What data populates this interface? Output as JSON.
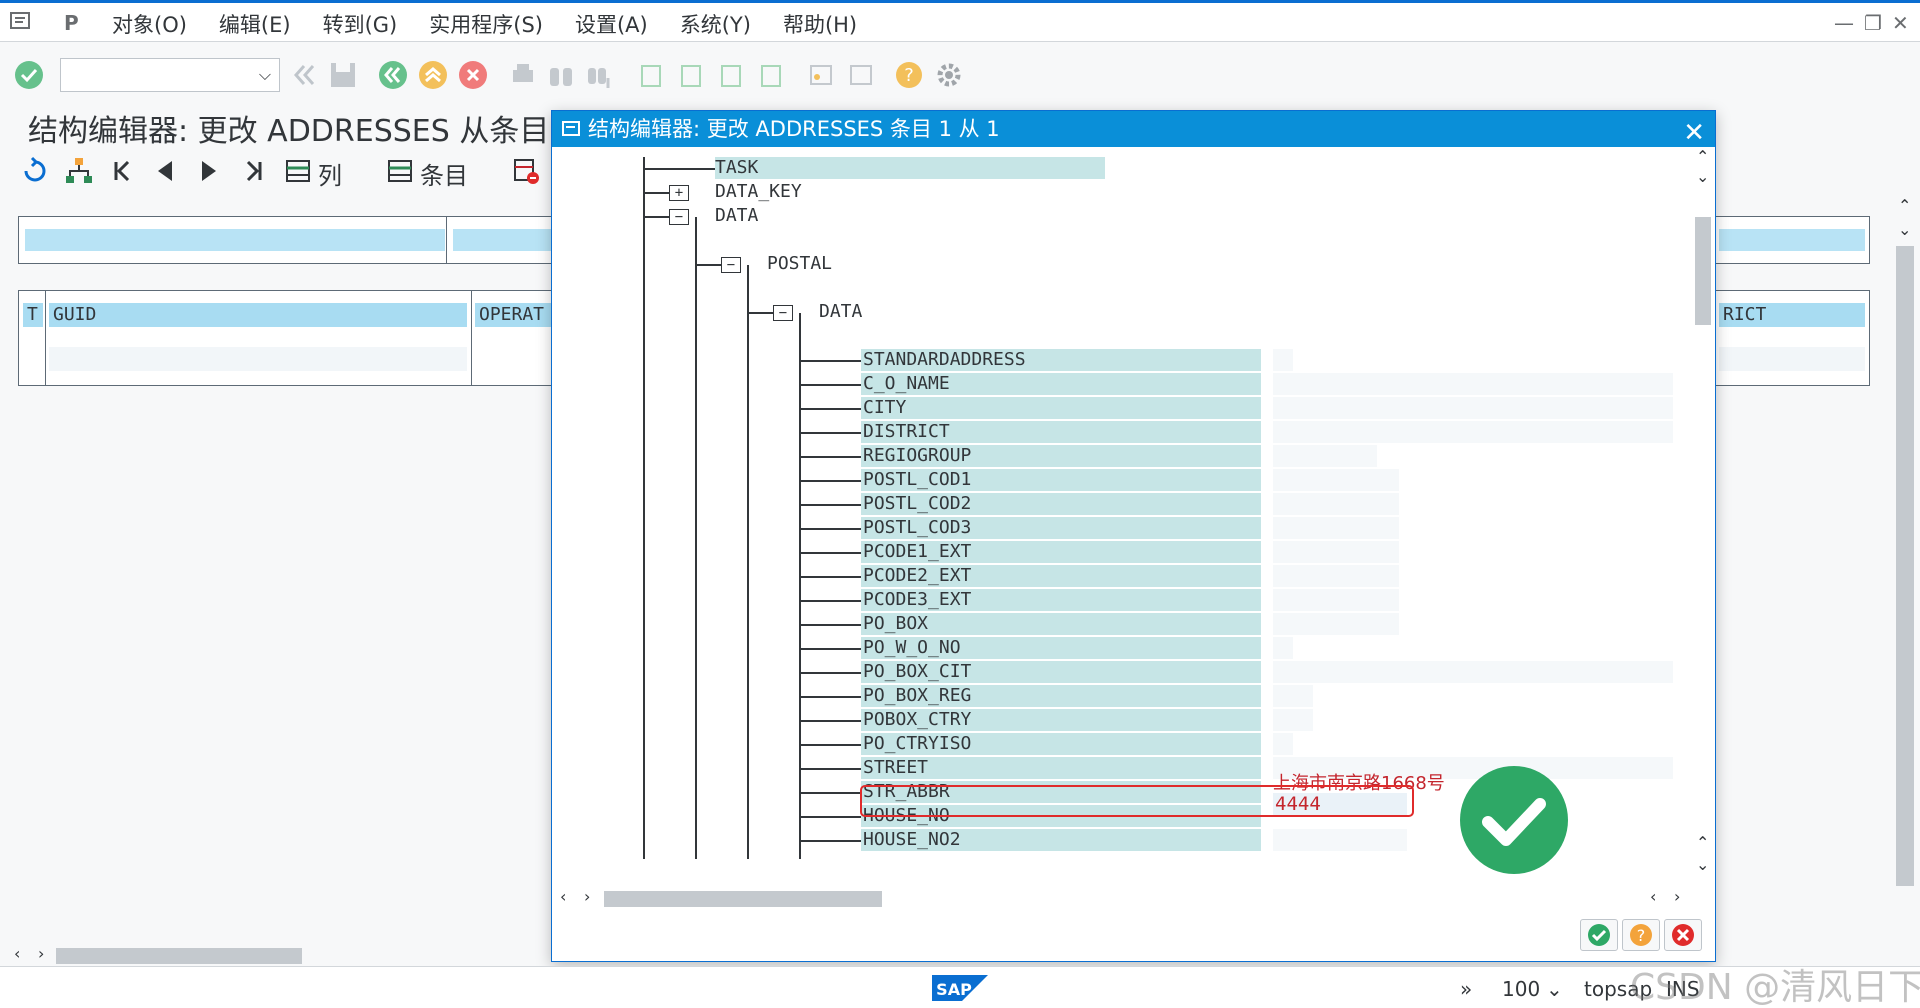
{
  "menu": {
    "items": [
      "对象(O)",
      "编辑(E)",
      "转到(G)",
      "实用程序(S)",
      "设置(A)",
      "系统(Y)",
      "帮助(H)"
    ]
  },
  "window_controls": [
    "—",
    "❐",
    "✕"
  ],
  "main": {
    "title": "结构编辑器: 更改 ADDRESSES 从条目",
    "app_toolbar": {
      "columns_label": "列",
      "entries_label": "条目"
    },
    "grid": {
      "headers": [
        "T",
        "GUID",
        "OPERAT",
        "RICT"
      ]
    }
  },
  "dialog": {
    "title": "结构编辑器: 更改 ADDRESSES 条目 1 从 1",
    "close": "✕",
    "nodes": [
      {
        "label": "TASK"
      },
      {
        "label": "DATA_KEY"
      },
      {
        "label": "DATA"
      },
      {
        "label": "POSTAL"
      },
      {
        "label": "DATA"
      }
    ],
    "fields": [
      "STANDARDADDRESS",
      "C_O_NAME",
      "CITY",
      "DISTRICT",
      "REGIOGROUP",
      "POSTL_COD1",
      "POSTL_COD2",
      "POSTL_COD3",
      "PCODE1_EXT",
      "PCODE2_EXT",
      "PCODE3_EXT",
      "PO_BOX",
      "PO_W_O_NO",
      "PO_BOX_CIT",
      "PO_BOX_REG",
      "POBOX_CTRY",
      "PO_CTRYISO",
      "STREET",
      "STR_ABBR",
      "HOUSE_NO",
      "HOUSE_NO2"
    ],
    "street_value": "上海市南京路1668号",
    "house_no_value": "4444",
    "expander_plus": "+",
    "expander_minus": "−"
  },
  "status": {
    "zoom": "100",
    "system": "topsap",
    "mode": "INS",
    "watermark": "CSDN @清风日下"
  },
  "colors": {
    "accent": "#0a6ed1",
    "title_bar": "#0a8fd8",
    "node_bg": "#c6e5e6",
    "highlight": "#e02b2b",
    "value_text": "#c4252d",
    "check_green": "#2ea866"
  }
}
